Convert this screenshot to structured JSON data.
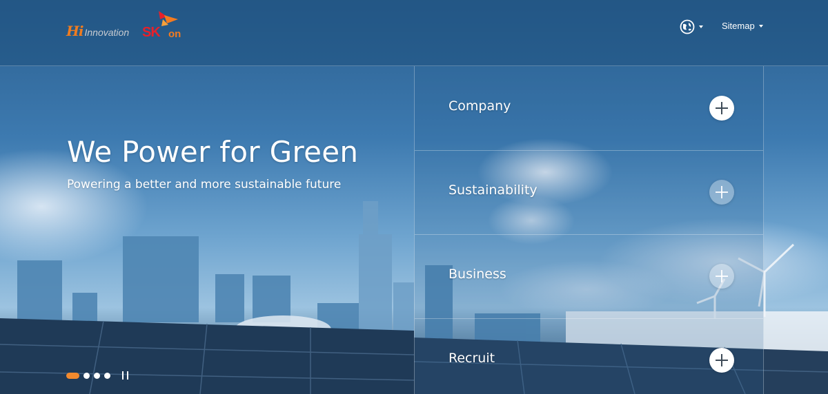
{
  "header": {
    "logo_hi_mark": "Hi",
    "logo_hi_text": "Innovation",
    "logo_sk_text": "SK",
    "logo_on_text": "on",
    "sitemap_label": "Sitemap",
    "language_icon": "globe-icon"
  },
  "hero": {
    "title": "We Power for Green",
    "subtitle": "Powering a better and more sustainable future"
  },
  "menu": {
    "items": [
      {
        "label": "Company",
        "icon": "plus-icon"
      },
      {
        "label": "Sustainability",
        "icon": "plus-icon"
      },
      {
        "label": "Business",
        "icon": "plus-icon"
      },
      {
        "label": "Recruit",
        "icon": "plus-icon"
      }
    ]
  },
  "slider": {
    "slide_count": 4,
    "active_slide": 1,
    "pause_icon": "pause-icon"
  },
  "colors": {
    "accent_orange": "#f28a2e",
    "sk_red": "#e8202a",
    "sky_blue": "#3d7ab0"
  }
}
